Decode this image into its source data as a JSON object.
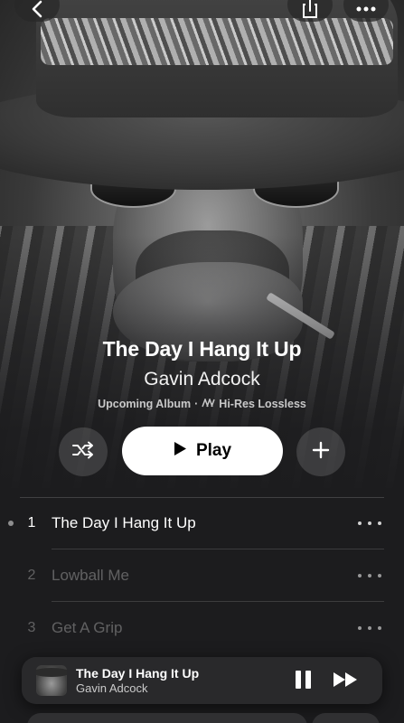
{
  "album": {
    "title": "The Day I Hang It Up",
    "artist": "Gavin Adcock",
    "status": "Upcoming Album",
    "separator": "·",
    "quality": "Hi-Res Lossless"
  },
  "actions": {
    "play_label": "Play"
  },
  "tracks": [
    {
      "number": "1",
      "title": "The Day I Hang It Up",
      "available": true
    },
    {
      "number": "2",
      "title": "Lowball Me",
      "available": false
    },
    {
      "number": "3",
      "title": "Get A Grip",
      "available": false
    }
  ],
  "now_playing": {
    "title": "The Day I Hang It Up",
    "artist": "Gavin Adcock"
  },
  "icons": {
    "back": "chevron-left-icon",
    "share": "share-icon",
    "more": "ellipsis-icon",
    "shuffle": "shuffle-icon",
    "play": "play-icon",
    "add": "plus-icon",
    "quality": "lossless-waveform-icon",
    "pause": "pause-icon",
    "forward": "fast-forward-icon"
  },
  "colors": {
    "background": "#1c1c1e",
    "play_button": "#ffffff",
    "text_primary": "#ffffff"
  }
}
